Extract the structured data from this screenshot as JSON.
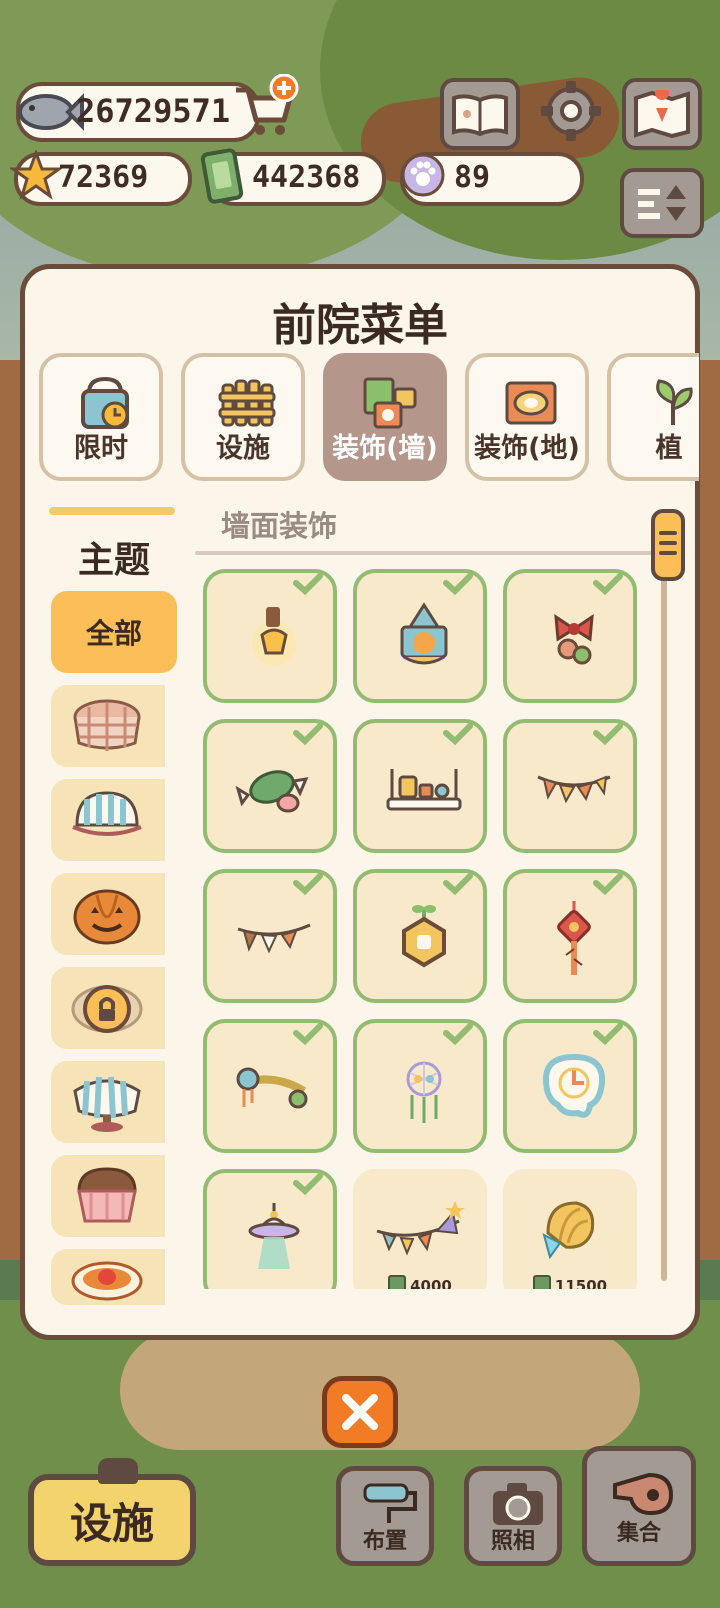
{
  "hud": {
    "fish_coins": "26729571",
    "stars": "72369",
    "tickets": "442368",
    "paw_tokens": "89",
    "icons": [
      "fish-icon",
      "shop-cart-icon",
      "star-icon",
      "ticket-icon",
      "paw-icon",
      "guidebook-icon",
      "gear-icon",
      "map-icon",
      "sort-toggle-icon"
    ]
  },
  "panel": {
    "title": "前院菜单",
    "tabs": [
      {
        "label": "限时",
        "icon": "limited-bag-icon",
        "active": false
      },
      {
        "label": "设施",
        "icon": "fence-icon",
        "active": false
      },
      {
        "label": "装饰(墙)",
        "icon": "wall-deco-icon",
        "active": true
      },
      {
        "label": "装饰(地)",
        "icon": "floor-deco-icon",
        "active": false
      },
      {
        "label": "植",
        "icon": "plant-icon",
        "active": false
      }
    ],
    "sidebar": {
      "title": "主题",
      "all_label": "全部",
      "themes": [
        "plaid-table-icon",
        "striped-canopy-table-icon",
        "pumpkin-icon",
        "locked-theme-icon",
        "striped-round-table-icon",
        "cupcake-icon",
        "strawberry-cake-icon"
      ]
    },
    "section_title": "墙面装饰",
    "items": [
      {
        "icon": "wall-lamp-icon",
        "owned": true
      },
      {
        "icon": "cat-pennant-icon",
        "owned": true
      },
      {
        "icon": "bow-ornament-icon",
        "owned": true
      },
      {
        "icon": "candy-icon",
        "owned": true
      },
      {
        "icon": "wall-shelf-icon",
        "owned": true
      },
      {
        "icon": "bunting-flags-icon",
        "owned": true
      },
      {
        "icon": "bunting-flags-2-icon",
        "owned": true
      },
      {
        "icon": "hexagon-sprout-icon",
        "owned": true
      },
      {
        "icon": "chinese-knot-icon",
        "owned": true
      },
      {
        "icon": "scarf-garland-icon",
        "owned": true
      },
      {
        "icon": "dreamcatcher-icon",
        "owned": true
      },
      {
        "icon": "melting-clock-icon",
        "owned": true
      },
      {
        "icon": "ufo-lamp-icon",
        "owned": true
      },
      {
        "icon": "party-bunting-icon",
        "owned": false,
        "price": "4000"
      },
      {
        "icon": "shell-ribbon-icon",
        "owned": false,
        "price": "11500"
      }
    ]
  },
  "bottom": {
    "facility_label": "设施",
    "layout_label": "布置",
    "photo_label": "照相",
    "gather_label": "集合"
  },
  "colors": {
    "panel_bg": "#fcf6ea",
    "border_brown": "#6b4b3a",
    "active_tab": "#b5968a",
    "accent_yellow": "#fbbe58",
    "owned_green": "#93bb72",
    "close_orange": "#f27b25"
  }
}
